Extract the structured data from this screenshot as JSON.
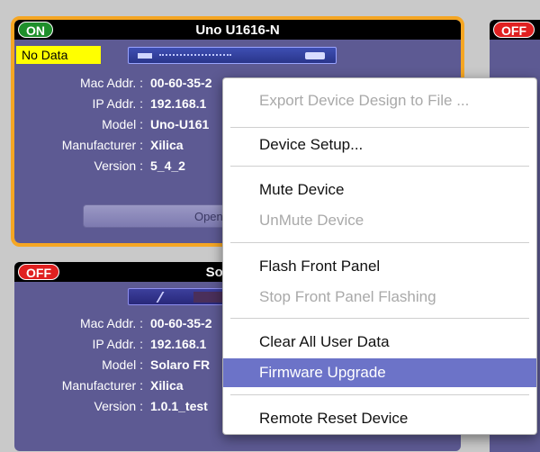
{
  "device1": {
    "status": "ON",
    "name": "Uno U1616-N",
    "no_data": "No Data",
    "labels": [
      "Mac Addr. :",
      "IP Addr. :",
      "Model :",
      "Manufacturer :",
      "Version :"
    ],
    "values": [
      "00-60-35-2",
      "192.168.1",
      "Uno-U161",
      "Xilica",
      "5_4_2"
    ],
    "open_button": "Open De"
  },
  "device2": {
    "status": "OFF",
    "name": "Sol",
    "labels": [
      "Mac Addr. :",
      "IP Addr. :",
      "Model :",
      "Manufacturer :",
      "Version :"
    ],
    "values": [
      "00-60-35-2",
      "192.168.1",
      "Solaro FR",
      "Xilica",
      "1.0.1_test"
    ]
  },
  "device3": {
    "status": "OFF"
  },
  "context_menu": {
    "items": [
      {
        "label": "Export Device Design to File ...",
        "state": "disabled"
      },
      {
        "label": "Device Setup...",
        "state": "enabled"
      },
      {
        "label": "Mute Device",
        "state": "enabled"
      },
      {
        "label": "UnMute Device",
        "state": "disabled"
      },
      {
        "label": "Flash Front Panel",
        "state": "enabled"
      },
      {
        "label": "Stop Front Panel Flashing",
        "state": "disabled"
      },
      {
        "label": "Clear All User Data",
        "state": "enabled"
      },
      {
        "label": "Firmware Upgrade",
        "state": "highlighted"
      },
      {
        "label": "Remote Reset Device",
        "state": "enabled"
      }
    ]
  },
  "colors": {
    "card": "#5d5a93",
    "selection": "#f5a623",
    "on": "#1e8f2b",
    "off": "#e02020",
    "highlight": "#6c73c8"
  }
}
